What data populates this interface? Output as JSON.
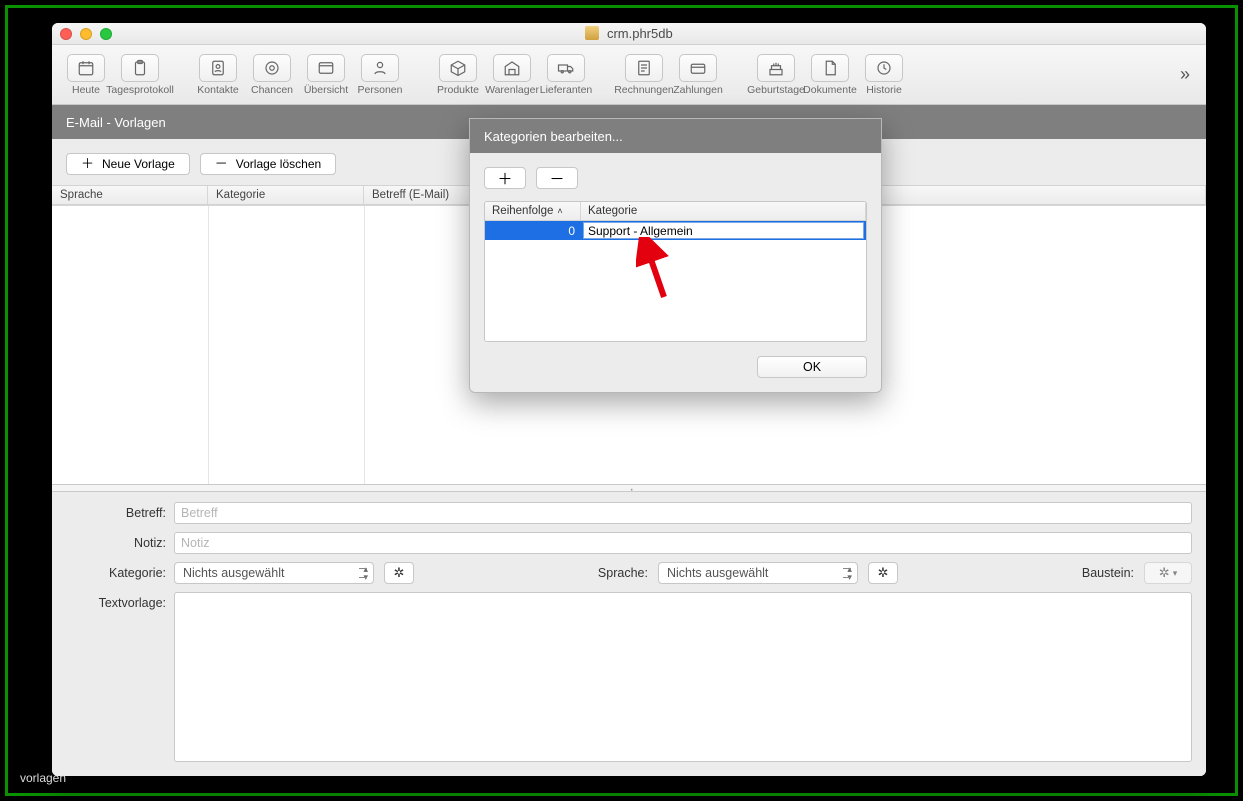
{
  "window": {
    "title": "crm.phr5db"
  },
  "toolbar": {
    "items": [
      {
        "label": "Heute",
        "icon": "calendar"
      },
      {
        "label": "Tagesprotokoll",
        "icon": "clipboard"
      },
      {
        "label": "Kontakte",
        "icon": "contact"
      },
      {
        "label": "Chancen",
        "icon": "opportunity"
      },
      {
        "label": "Übersicht",
        "icon": "overview"
      },
      {
        "label": "Personen",
        "icon": "person"
      },
      {
        "label": "Produkte",
        "icon": "box"
      },
      {
        "label": "Warenlager",
        "icon": "warehouse"
      },
      {
        "label": "Lieferanten",
        "icon": "truck"
      },
      {
        "label": "Rechnungen",
        "icon": "invoice"
      },
      {
        "label": "Zahlungen",
        "icon": "payment"
      },
      {
        "label": "Geburtstage",
        "icon": "cake"
      },
      {
        "label": "Dokumente",
        "icon": "document"
      },
      {
        "label": "Historie",
        "icon": "history"
      }
    ],
    "overflow": "»"
  },
  "section_title": "E-Mail - Vorlagen",
  "actions": {
    "new_label": "Neue Vorlage",
    "delete_label": "Vorlage löschen"
  },
  "columns": {
    "lang": "Sprache",
    "cat": "Kategorie",
    "subject": "Betreff (E-Mail)"
  },
  "form": {
    "betreff_label": "Betreff:",
    "betreff_placeholder": "Betreff",
    "notiz_label": "Notiz:",
    "notiz_placeholder": "Notiz",
    "kategorie_label": "Kategorie:",
    "sprache_label": "Sprache:",
    "baustein_label": "Baustein:",
    "select_none": "Nichts ausgewählt",
    "textvorlage_label": "Textvorlage:"
  },
  "modal": {
    "title": "Kategorien bearbeiten...",
    "col_order": "Reihenfolge",
    "col_cat": "Kategorie",
    "row_order": "0",
    "row_cat_value": "Support - Allgemein",
    "ok": "OK"
  },
  "caption": "vorlagen"
}
